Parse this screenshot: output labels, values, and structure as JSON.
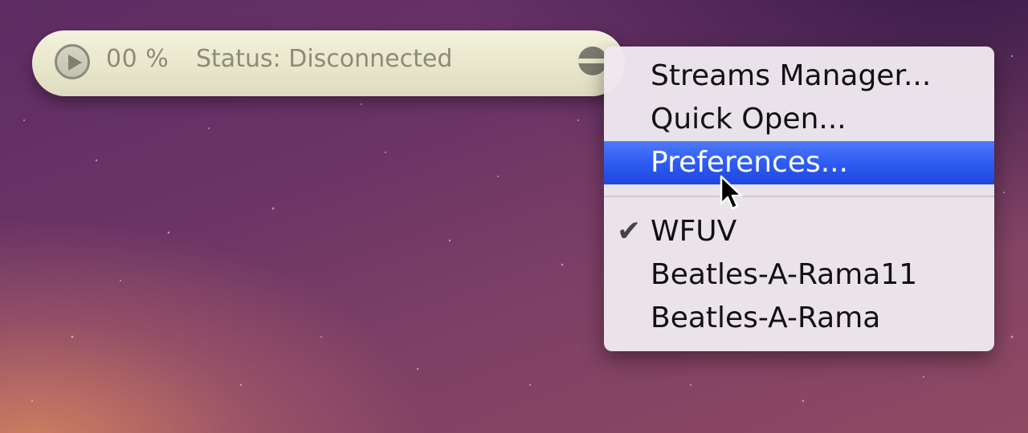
{
  "player": {
    "play_icon": "play-icon",
    "percent": "00 %",
    "status": "Status: Disconnected",
    "menu_icon": "menu-toggle-icon"
  },
  "menu": {
    "actions": [
      "Streams Manager...",
      "Quick Open...",
      "Preferences..."
    ],
    "highlighted": "Preferences...",
    "streams": [
      "WFUV",
      "Beatles-A-Rama11",
      "Beatles-A-Rama"
    ],
    "checked_stream": "WFUV",
    "check_mark": "✔"
  },
  "colors": {
    "bar_background": "#e8e7cb",
    "bar_text": "#8c8b78",
    "menu_background": "#eee8ee",
    "highlight": "#2e5cf2"
  }
}
